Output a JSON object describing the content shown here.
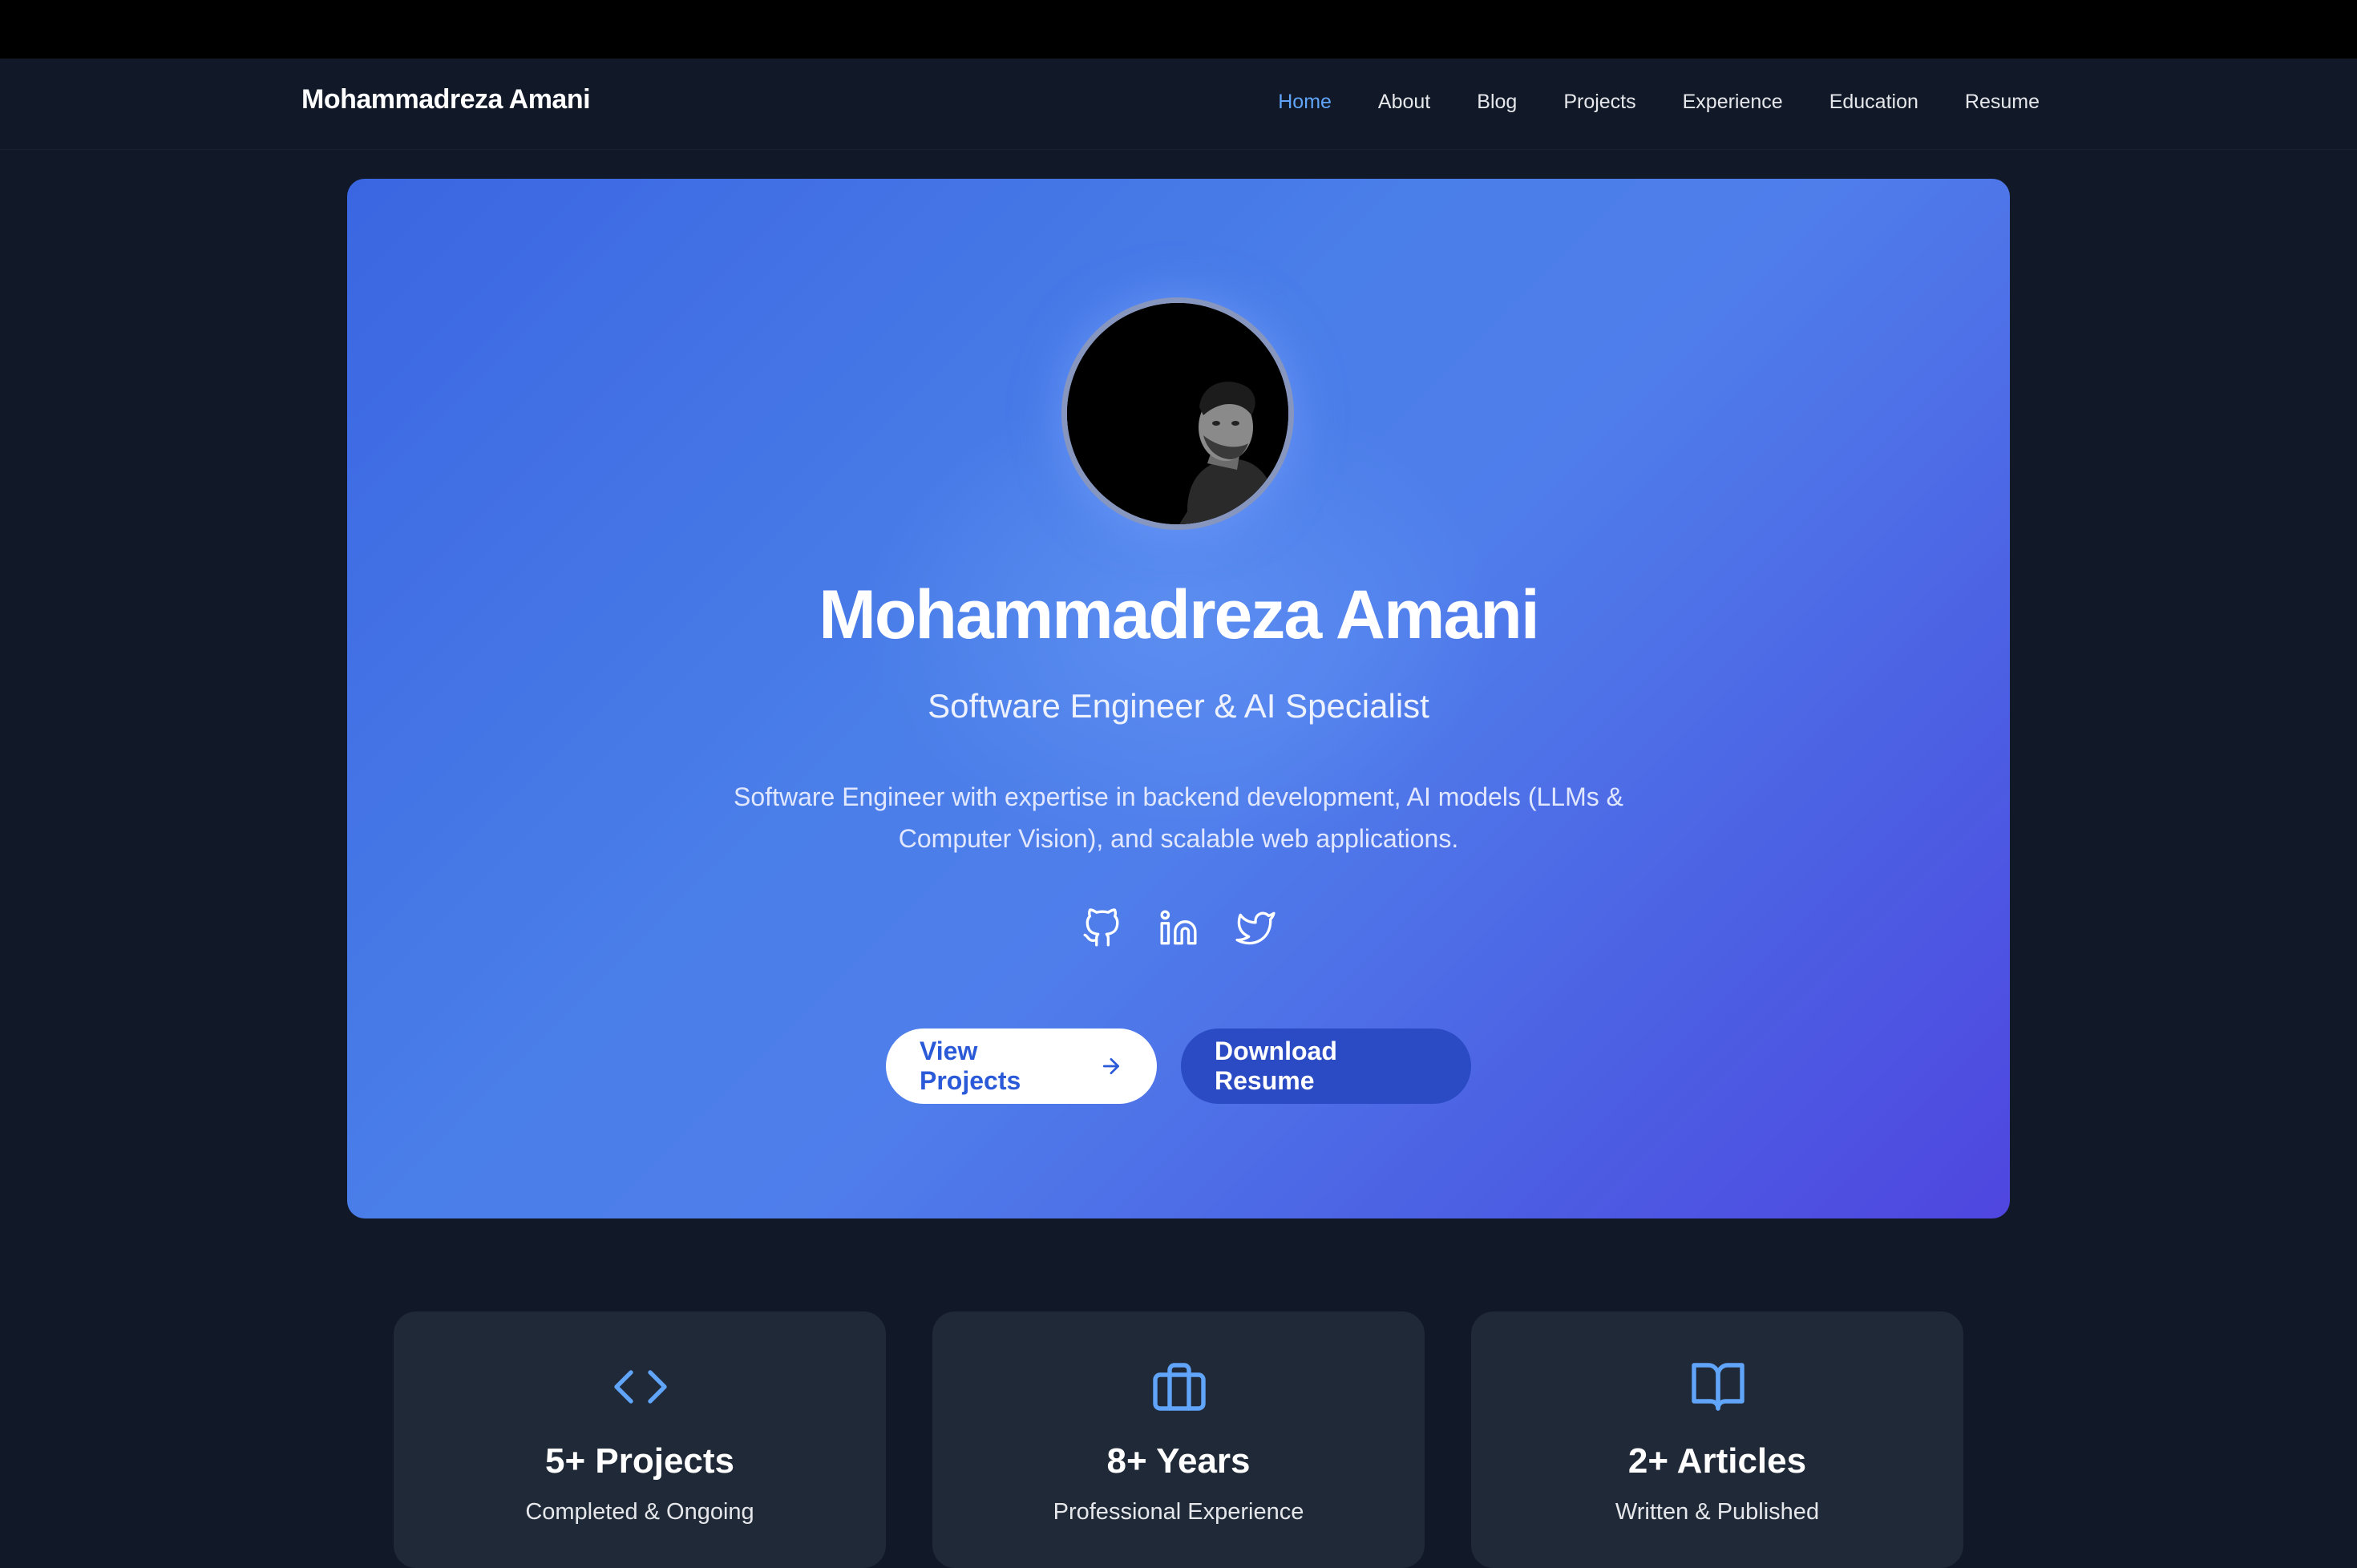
{
  "nav": {
    "brand": "Mohammadreza Amani",
    "links": [
      {
        "label": "Home",
        "active": true
      },
      {
        "label": "About"
      },
      {
        "label": "Blog"
      },
      {
        "label": "Projects"
      },
      {
        "label": "Experience"
      },
      {
        "label": "Education"
      },
      {
        "label": "Resume"
      }
    ]
  },
  "hero": {
    "name": "Mohammadreza Amani",
    "subtitle": "Software Engineer & AI Specialist",
    "description": "Software Engineer with expertise in backend development, AI models (LLMs & Computer Vision), and scalable web applications.",
    "socials": [
      "github-icon",
      "linkedin-icon",
      "twitter-icon"
    ],
    "primary_button": "View Projects",
    "secondary_button": "Download Resume"
  },
  "stats": [
    {
      "icon": "code-icon",
      "title": "5+ Projects",
      "subtitle": "Completed & Ongoing"
    },
    {
      "icon": "briefcase-icon",
      "title": "8+ Years",
      "subtitle": "Professional Experience"
    },
    {
      "icon": "book-open-icon",
      "title": "2+ Articles",
      "subtitle": "Written & Published"
    }
  ],
  "colors": {
    "background": "#111827",
    "accent": "#60a5fa",
    "card": "#1f2937",
    "hero_start": "#3b66e2",
    "hero_end": "#4f46e0"
  }
}
